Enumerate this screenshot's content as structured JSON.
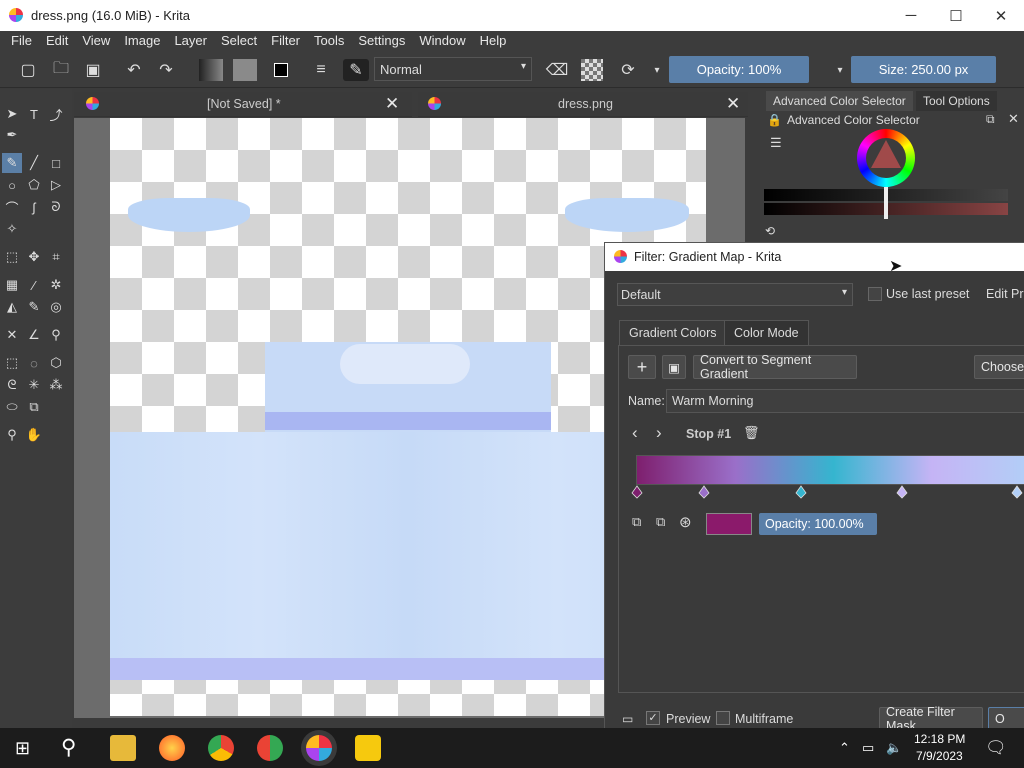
{
  "window": {
    "title": "dress.png (16.0 MiB)  - Krita"
  },
  "menu": [
    "File",
    "Edit",
    "View",
    "Image",
    "Layer",
    "Select",
    "Filter",
    "Tools",
    "Settings",
    "Window",
    "Help"
  ],
  "toolbar": {
    "blend_mode": "Normal",
    "opacity": "Opacity: 100%",
    "size": "Size: 250.00 px"
  },
  "tabs": [
    {
      "label": "[Not Saved]  *"
    },
    {
      "label": "dress.png"
    }
  ],
  "docker": {
    "tabs": [
      "Advanced Color Selector",
      "Tool Options"
    ],
    "panel_title": "Advanced Color Selector"
  },
  "dialog": {
    "title": "Filter: Gradient Map - Krita",
    "preset": "Default",
    "use_last_preset": "Use last preset",
    "edit_presets": "Edit Pr",
    "tabs": [
      "Gradient Colors",
      "Color Mode"
    ],
    "convert_button": "Convert to Segment Gradient",
    "choose_button": "Choose",
    "name_label": "Name:",
    "name_value": "Warm Morning",
    "stop_label": "Stop #1",
    "stop_opacity": "Opacity: 100.00%",
    "preview": "Preview",
    "multiframe": "Multiframe",
    "create_filter_mask": "Create Filter Mask",
    "ok": "O"
  },
  "gradient": {
    "stops": [
      "#7e1f6e",
      "#9a6fc9",
      "#35b5cf",
      "#c5b4f5",
      "#b2cff7"
    ],
    "stop_color": "#8b1a6b"
  },
  "taskbar": {
    "time": "12:18 PM",
    "date": "7/9/2023"
  }
}
